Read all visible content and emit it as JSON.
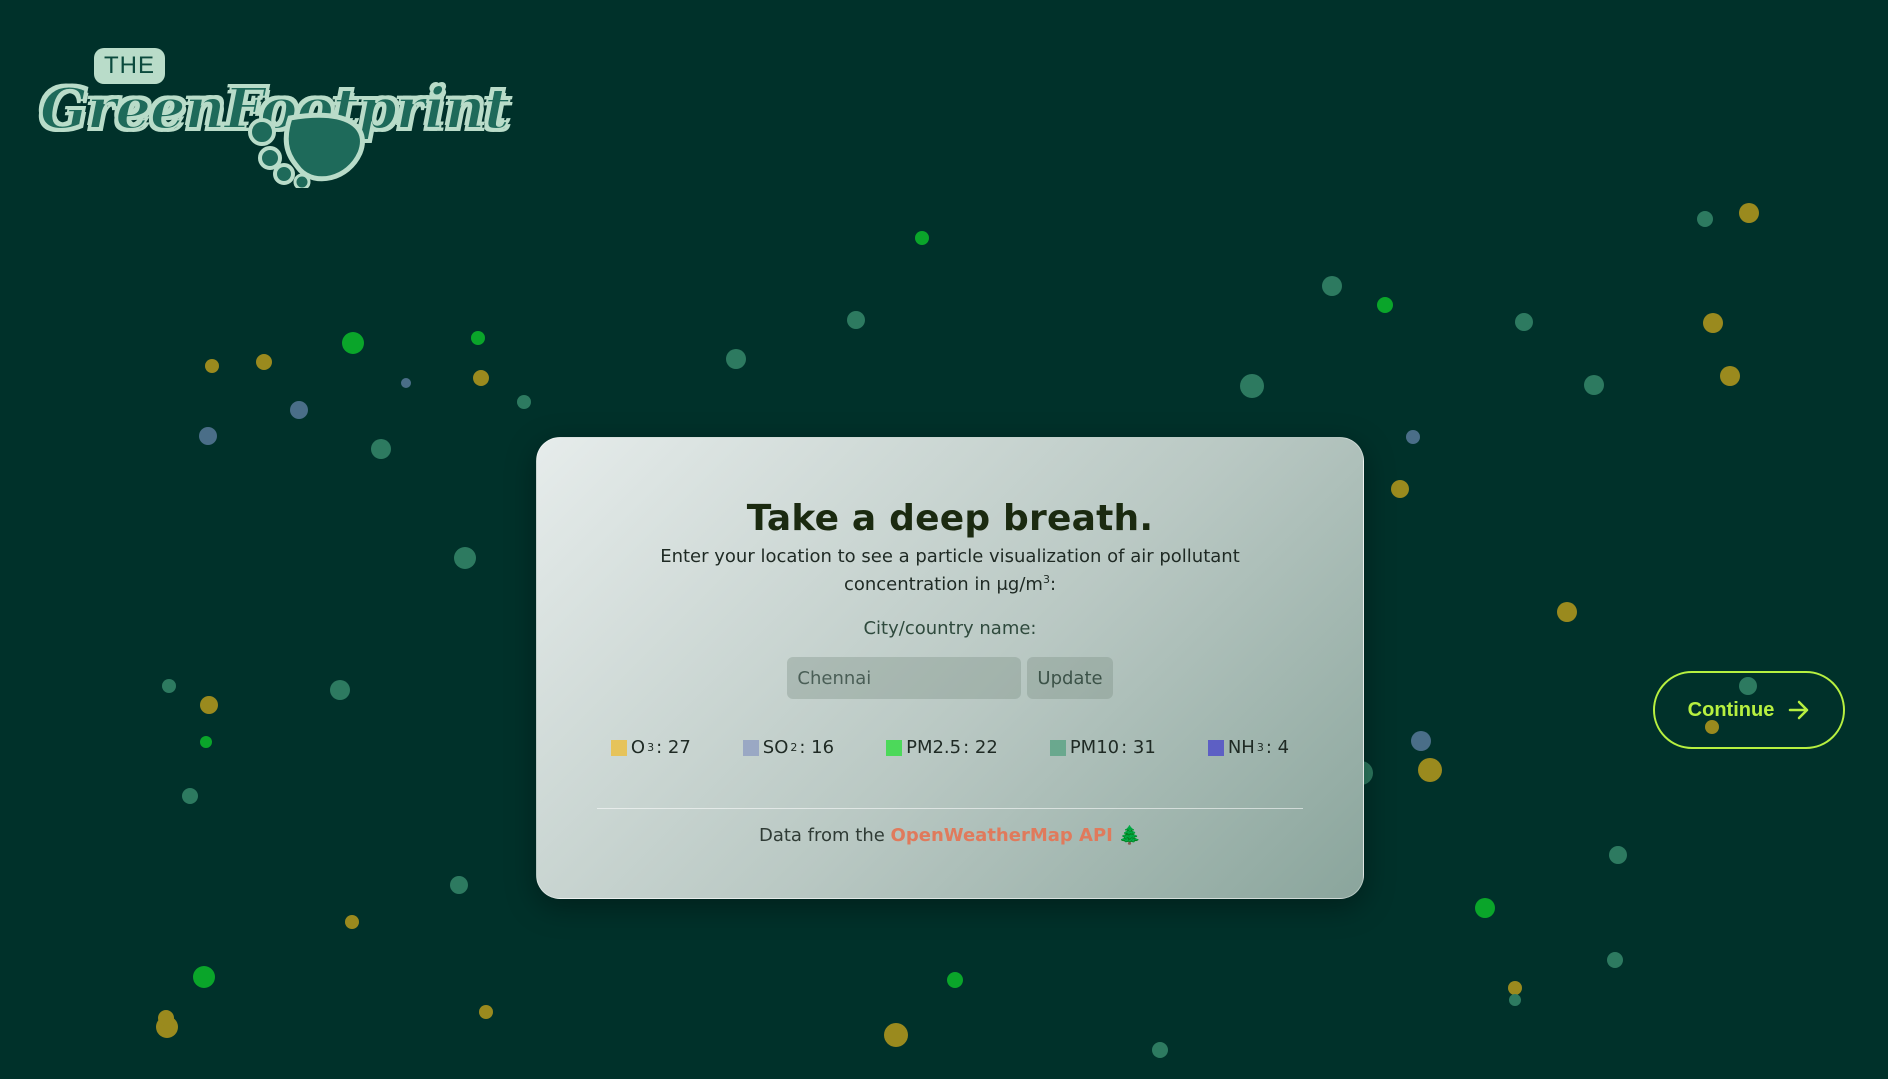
{
  "logo": {
    "the": "THE",
    "brand": "GreenFootprint"
  },
  "card": {
    "title": "Take a deep breath.",
    "subtitle_pre": "Enter your location to see a particle visualization of air pollutant concentration in μg/m",
    "subtitle_sup": "3",
    "subtitle_post": ":",
    "field_label": "City/country name:",
    "city_value": "Chennai",
    "update_label": "Update",
    "footer_pre": "Data from the ",
    "footer_link": "OpenWeatherMap API",
    "footer_icon": "🌲"
  },
  "legend": [
    {
      "name": "O",
      "sup": "3",
      "value": ": 27",
      "color": "#e6c35a"
    },
    {
      "name": "SO",
      "sup": "2",
      "value": ": 16",
      "color": "#9aa8c4"
    },
    {
      "name": "PM2.5",
      "sup": "",
      "value": ": 22",
      "color": "#4cd95a"
    },
    {
      "name": "PM10",
      "sup": "",
      "value": ": 31",
      "color": "#6aa88e"
    },
    {
      "name": "NH",
      "sup": "3",
      "value": ": 4",
      "color": "#5d5fc4"
    }
  ],
  "continue_label": "Continue",
  "colors": {
    "background": "#00312a",
    "accent": "#b7f040",
    "link": "#e07a5c"
  }
}
